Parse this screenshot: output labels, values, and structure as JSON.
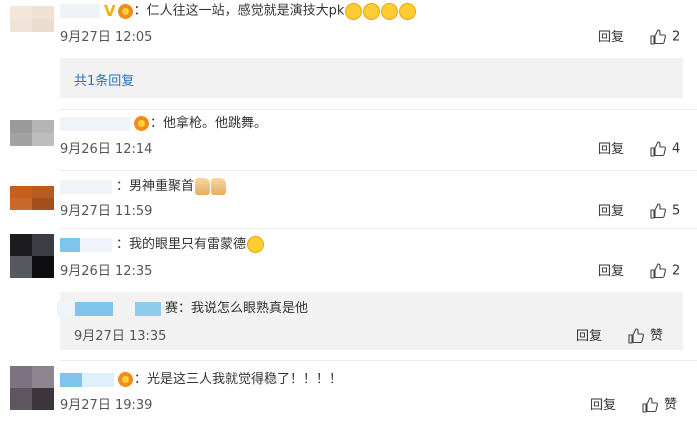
{
  "comments": [
    {
      "text": "：仁人往这一站，感觉就是演技大pk",
      "date": "9月27日 12:05",
      "reply": "回复",
      "likes": "2",
      "more_replies": "共1条回复"
    },
    {
      "text": "：他拿枪。他跳舞。",
      "date": "9月26日 12:14",
      "reply": "回复",
      "likes": "4"
    },
    {
      "text": "：男神重聚首",
      "date": "9月27日 11:59",
      "reply": "回复",
      "likes": "5"
    },
    {
      "text": "：我的眼里只有雷蒙德",
      "date": "9月26日 12:35",
      "reply": "回复",
      "likes": "2",
      "sub": {
        "text": "：我说怎么眼熟真是他",
        "date": "9月27日 13:35",
        "reply": "回复",
        "like_label": "赞"
      }
    },
    {
      "text": "：光是这三人我就觉得稳了！！！！",
      "date": "9月27日 19:39",
      "reply": "回复",
      "like_label": "赞"
    }
  ],
  "fragments": {
    "name2_tail": "赛"
  },
  "icons": {
    "like": "thumbs-up-icon",
    "badge": "member-badge-icon",
    "verified": "verified-v-icon"
  }
}
